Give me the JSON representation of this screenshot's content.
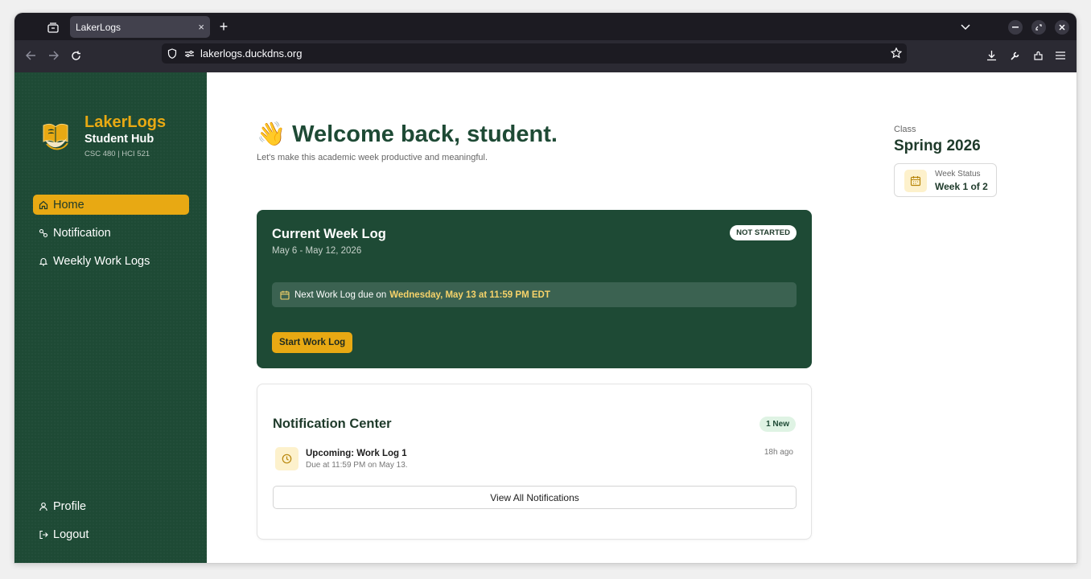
{
  "browser": {
    "tab_title": "LakerLogs",
    "tab_close": "×",
    "new_tab": "+",
    "url": "lakerlogs.duckdns.org"
  },
  "sidebar": {
    "brand_name": "LakerLogs",
    "brand_sub": "Student Hub",
    "brand_course": "CSC 480 | HCI 521",
    "nav": [
      {
        "label": "Home",
        "icon": "home-icon",
        "active": true
      },
      {
        "label": "Notification",
        "icon": "notification-icon",
        "active": false
      },
      {
        "label": "Weekly Work Logs",
        "icon": "bell-icon",
        "active": false
      }
    ],
    "bottom": [
      {
        "label": "Profile",
        "icon": "user-icon"
      },
      {
        "label": "Logout",
        "icon": "logout-icon"
      }
    ]
  },
  "header": {
    "emoji": "👋",
    "welcome": "Welcome back, student.",
    "tagline": "Let's make this academic week productive and meaningful."
  },
  "class_info": {
    "label": "Class",
    "value": "Spring 2026",
    "week_status_label": "Week Status",
    "week_status_value": "Week 1 of 2"
  },
  "current_week": {
    "title": "Current Week Log",
    "dates": "May 6 - May 12, 2026",
    "status_badge": "NOT STARTED",
    "due_prefix": "Next Work Log due on",
    "due_highlight": "Wednesday, May 13 at 11:59 PM EDT",
    "start_button": "Start Work Log"
  },
  "notifications": {
    "title": "Notification Center",
    "badge": "1 New",
    "items": [
      {
        "title": "Upcoming: Work Log 1",
        "detail": "Due at 11:59 PM on May 13.",
        "time": "18h ago"
      }
    ],
    "view_all": "View All Notifications"
  },
  "colors": {
    "sidebar_green": "#1e4a35",
    "accent_gold": "#e8a913",
    "badge_green": "#dff3e4"
  }
}
